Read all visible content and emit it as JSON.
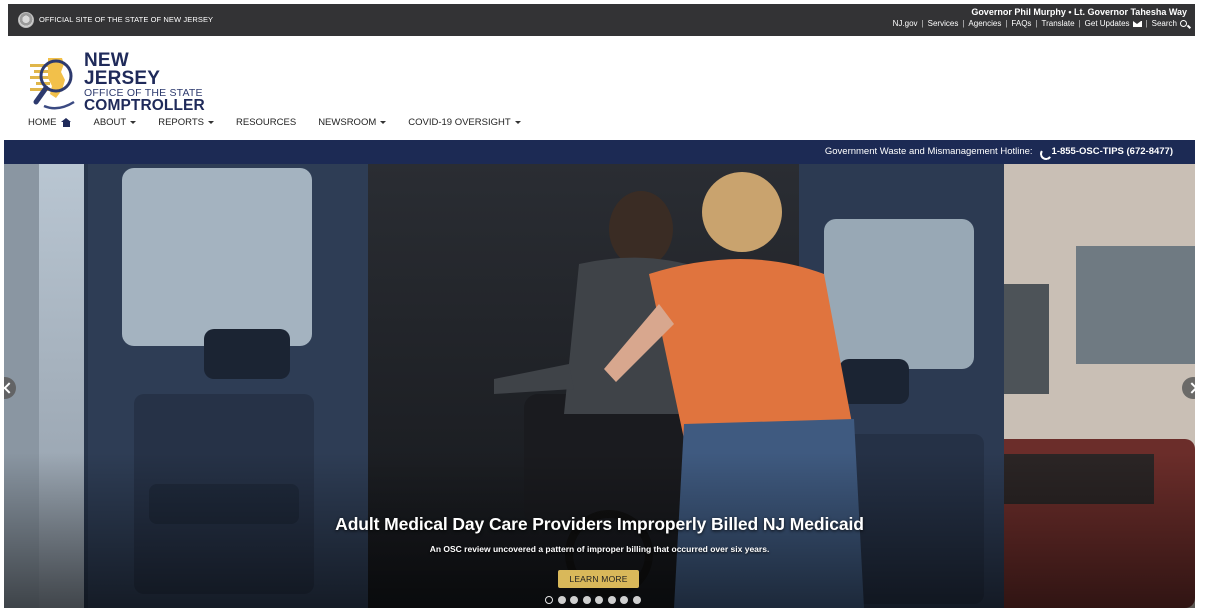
{
  "topbar": {
    "official_site": "OFFICIAL SITE OF THE STATE OF NEW JERSEY",
    "governor": "Governor Phil Murphy • Lt. Governor Tahesha Way",
    "links": [
      "NJ.gov",
      "Services",
      "Agencies",
      "FAQs",
      "Translate",
      "Get Updates",
      "Search"
    ]
  },
  "logo": {
    "line1": "NEW JERSEY",
    "line2": "OFFICE OF THE STATE",
    "line3": "COMPTROLLER"
  },
  "nav": {
    "items": [
      "HOME",
      "ABOUT",
      "REPORTS",
      "RESOURCES",
      "NEWSROOM",
      "COVID-19 OVERSIGHT"
    ]
  },
  "hotline": {
    "label": "Government Waste and Mismanagement Hotline:",
    "number": "1-855-OSC-TIPS (672-8477)"
  },
  "hero": {
    "title": "Adult Medical Day Care Providers Improperly Billed NJ Medicaid",
    "subtitle": "An OSC review uncovered a pattern of improper billing that occurred over six years.",
    "button": "LEARN MORE",
    "slide_count": 8,
    "active_slide": 1
  },
  "colors": {
    "topbar": "#333335",
    "navy": "#1c2a54",
    "gold": "#d9b85a"
  }
}
